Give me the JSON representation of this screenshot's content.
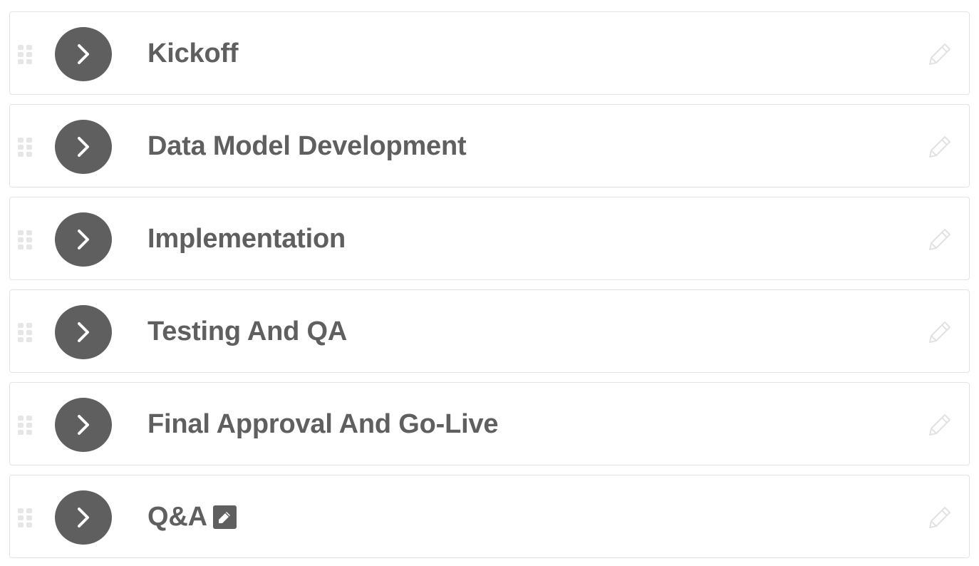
{
  "colors": {
    "row_border": "#e3e3e3",
    "circle_button": "#5f5f5f",
    "title_text": "#5f5f5f",
    "pencil_outline": "#e2e2e2",
    "drag_dots": "#e6e6e6"
  },
  "icons": {
    "expand": "chevron-right-icon",
    "drag": "drag-handle-icon",
    "edit": "pencil-outline-icon",
    "inline_edit": "pencil-square-icon"
  },
  "phases": [
    {
      "title": "Kickoff",
      "show_inline_edit": false
    },
    {
      "title": "Data Model Development",
      "show_inline_edit": false
    },
    {
      "title": "Implementation",
      "show_inline_edit": false
    },
    {
      "title": "Testing And QA",
      "show_inline_edit": false
    },
    {
      "title": "Final Approval And Go-Live",
      "show_inline_edit": false
    },
    {
      "title": "Q&A",
      "show_inline_edit": true
    }
  ]
}
